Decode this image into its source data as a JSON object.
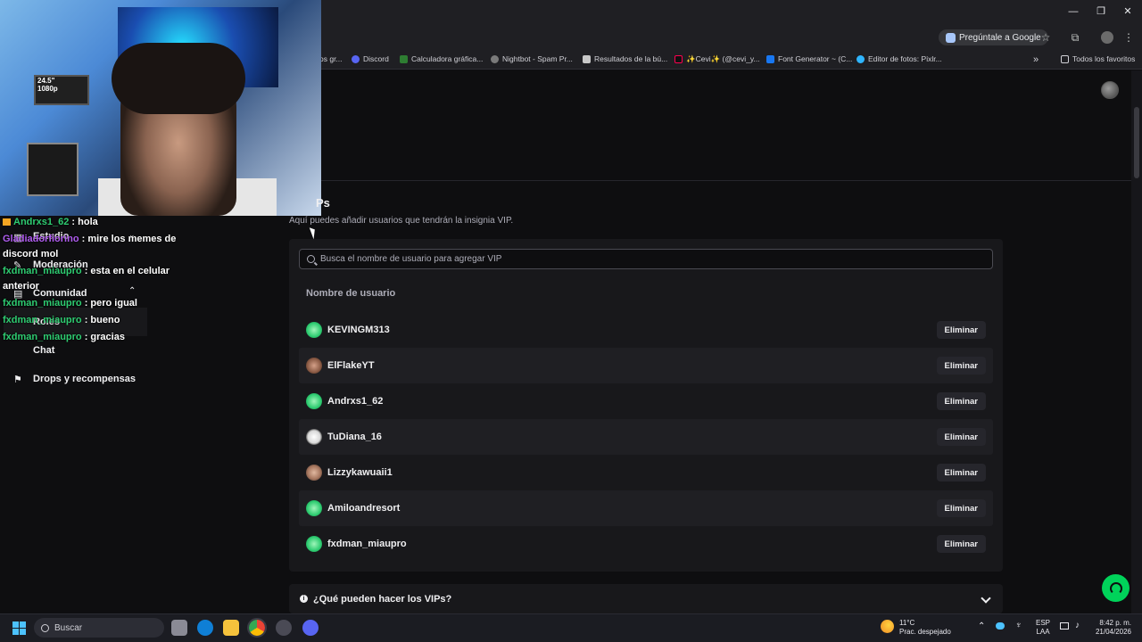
{
  "browser": {
    "ask_google": "Pregúntale a Google",
    "bookmarks": [
      "os gr...",
      "Discord",
      "Calculadora gráfica...",
      "Nightbot - Spam Pr...",
      "Resultados de la bú...",
      "✨Cevi✨ (@cevi_y...",
      "Font Generator ~ (C...",
      "Editor de fotos: Pixlr..."
    ],
    "bookmarks_overflow": "»",
    "all_favorites": "Todos los favoritos",
    "window_controls": [
      "—",
      "❐",
      "✕"
    ]
  },
  "sidebar": {
    "items": [
      {
        "label": "Estudio",
        "icon": "studio-icon"
      },
      {
        "label": "Moderación",
        "icon": "wrench-icon"
      },
      {
        "label": "Comunidad",
        "icon": "community-icon"
      },
      {
        "label": "Roles",
        "icon": ""
      },
      {
        "label": "Chat",
        "icon": ""
      },
      {
        "label": "Drops y recompensas",
        "icon": "drops-icon"
      }
    ]
  },
  "chat": {
    "lines": [
      {
        "user": "Andrxs1_62",
        "text": " : hola",
        "badge": "crown"
      },
      {
        "user": "Gladiadorfiorino",
        "text": " : mire los memes de"
      },
      {
        "user": "",
        "text": "discord mol"
      },
      {
        "user": "fxdman_miaupro",
        "text": " : esta en el celular"
      },
      {
        "user": "",
        "text": "anterior"
      },
      {
        "user": "fxdman_miaupro",
        "text": " : pero igual"
      },
      {
        "user": "fxdman_miaupro",
        "text": " : bueno"
      },
      {
        "user": "fxdman_miaupro",
        "text": " : gracias"
      }
    ]
  },
  "webcam": {
    "monitor_text_1": "24.5\"",
    "monitor_text_2": "1080p"
  },
  "vips": {
    "title": "VIPs",
    "title_visible": "Ps",
    "description": "Aquí puedes añadir usuarios que tendrán la insignia VIP.",
    "search_placeholder": "Busca el nombre de usuario para agregar VIP",
    "column_header": "Nombre de usuario",
    "remove_label": "Eliminar",
    "users": [
      {
        "name": "KEVINGM313",
        "avatar_color": "#2ecc71"
      },
      {
        "name": "ElFlakeYT",
        "avatar_color": "#8a5a44"
      },
      {
        "name": "Andrxs1_62",
        "avatar_color": "#2ecc71"
      },
      {
        "name": "TuDiana_16",
        "avatar_color": "#e8e8e8"
      },
      {
        "name": "Lizzykawuaii1",
        "avatar_color": "#a87860"
      },
      {
        "name": "Amiloandresort",
        "avatar_color": "#2ecc71"
      },
      {
        "name": "fxdman_miaupro",
        "avatar_color": "#2ecc71"
      }
    ],
    "faq": "¿Qué pueden hacer los VIPs?"
  },
  "taskbar": {
    "search": "Buscar",
    "weather_temp": "11°C",
    "weather_desc": "Prac. despejado",
    "lang_1": "ESP",
    "lang_2": "LAA",
    "time": "8:42 p. m.",
    "date": "21/04/2026"
  },
  "colors": {
    "background": "#0e0e10",
    "panel": "#18181b",
    "accent_green": "#00d35a",
    "chat_user": "#2ecc71"
  }
}
